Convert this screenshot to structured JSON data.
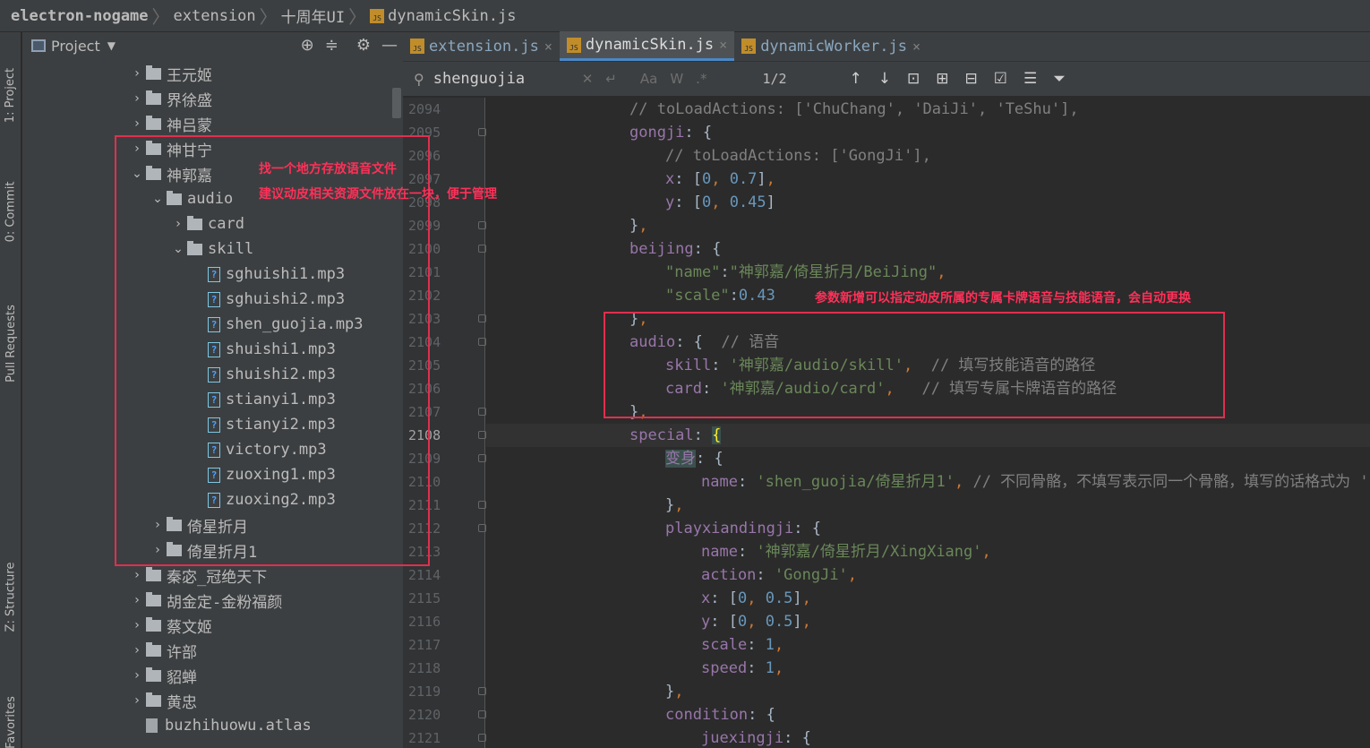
{
  "breadcrumb": {
    "root": "electron-nogame",
    "parts": [
      "extension",
      "十周年UI"
    ],
    "file": "dynamicSkin.js"
  },
  "left_tool_tabs": [
    "1: Project",
    "0: Commit",
    "Pull Requests",
    "Z: Structure",
    "Favorites"
  ],
  "project_panel": {
    "title": "Project"
  },
  "tree": [
    {
      "label": "王元姬",
      "kind": "folder",
      "expanded": false,
      "depth": 0
    },
    {
      "label": "界徐盛",
      "kind": "folder",
      "expanded": false,
      "depth": 0
    },
    {
      "label": "神吕蒙",
      "kind": "folder",
      "expanded": false,
      "depth": 0
    },
    {
      "label": "神甘宁",
      "kind": "folder",
      "expanded": false,
      "depth": 0
    },
    {
      "label": "神郭嘉",
      "kind": "folder",
      "expanded": true,
      "depth": 0
    },
    {
      "label": "audio",
      "kind": "folder",
      "expanded": true,
      "depth": 1
    },
    {
      "label": "card",
      "kind": "folder",
      "expanded": false,
      "depth": 2
    },
    {
      "label": "skill",
      "kind": "folder",
      "expanded": true,
      "depth": 2
    },
    {
      "label": "sghuishi1.mp3",
      "kind": "file",
      "depth": 3
    },
    {
      "label": "sghuishi2.mp3",
      "kind": "file",
      "depth": 3
    },
    {
      "label": "shen_guojia.mp3",
      "kind": "file",
      "depth": 3
    },
    {
      "label": "shuishi1.mp3",
      "kind": "file",
      "depth": 3
    },
    {
      "label": "shuishi2.mp3",
      "kind": "file",
      "depth": 3
    },
    {
      "label": "stianyi1.mp3",
      "kind": "file",
      "depth": 3
    },
    {
      "label": "stianyi2.mp3",
      "kind": "file",
      "depth": 3
    },
    {
      "label": "victory.mp3",
      "kind": "file",
      "depth": 3
    },
    {
      "label": "zuoxing1.mp3",
      "kind": "file",
      "depth": 3
    },
    {
      "label": "zuoxing2.mp3",
      "kind": "file",
      "depth": 3
    },
    {
      "label": "倚星折月",
      "kind": "folder",
      "expanded": false,
      "depth": 1
    },
    {
      "label": "倚星折月1",
      "kind": "folder",
      "expanded": false,
      "depth": 1
    },
    {
      "label": "秦宓_冠绝天下",
      "kind": "folder",
      "expanded": false,
      "depth": 0
    },
    {
      "label": "胡金定-金粉福颜",
      "kind": "folder",
      "expanded": false,
      "depth": 0
    },
    {
      "label": "蔡文姬",
      "kind": "folder",
      "expanded": false,
      "depth": 0
    },
    {
      "label": "许部",
      "kind": "folder",
      "expanded": false,
      "depth": 0
    },
    {
      "label": "貂蝉",
      "kind": "folder",
      "expanded": false,
      "depth": 0
    },
    {
      "label": "黄忠",
      "kind": "folder",
      "expanded": false,
      "depth": 0
    },
    {
      "label": "buzhihuowu.atlas",
      "kind": "atlas",
      "depth": 0
    }
  ],
  "editor_tabs": [
    {
      "label": "extension.js",
      "active": false
    },
    {
      "label": "dynamicSkin.js",
      "active": true
    },
    {
      "label": "dynamicWorker.js",
      "active": false
    }
  ],
  "find": {
    "query": "shenguojia",
    "match_case": "Aa",
    "words": "W",
    "regex": ".*",
    "count": "1/2"
  },
  "line_numbers": [
    "2094",
    "2095",
    "2096",
    "2097",
    "2098",
    "2099",
    "2100",
    "2101",
    "2102",
    "2103",
    "2104",
    "2105",
    "2106",
    "2107",
    "2108",
    "2109",
    "2110",
    "2111",
    "2112",
    "2113",
    "2114",
    "2115",
    "2116",
    "2117",
    "2118",
    "2119",
    "2120",
    "2121"
  ],
  "current_line": "2108",
  "annotations": {
    "tree_note_1": "找一个地方存放语音文件",
    "tree_note_2": "建议动皮相关资源文件放在一块，便于管理",
    "code_note": "参数新增可以指定动皮所属的专属卡牌语音与技能语音，会自动更换"
  },
  "colors": {
    "annotation": "#e02f4e",
    "keyword": "#cc7832",
    "string": "#6a8759",
    "number": "#6897bb",
    "property": "#9876aa",
    "comment": "#808080"
  }
}
